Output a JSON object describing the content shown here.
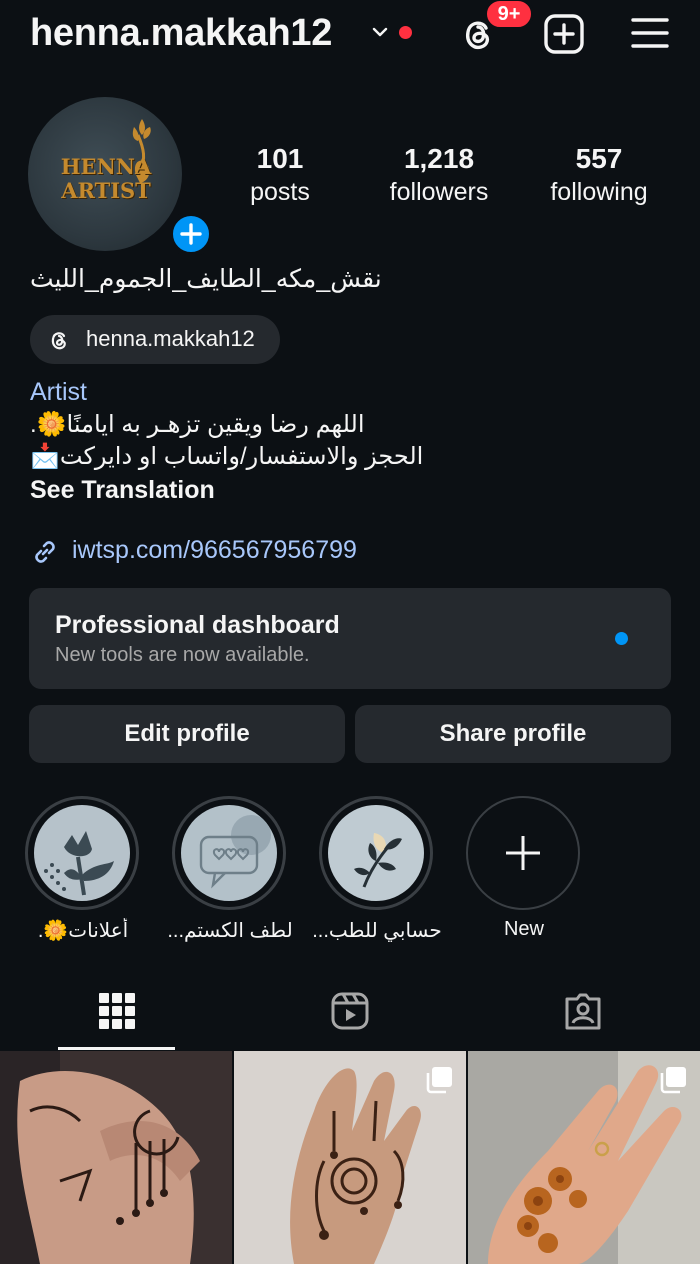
{
  "header": {
    "username": "henna.makkah12",
    "notification_badge": "9+"
  },
  "profile": {
    "avatar_text_line1": "HENNA",
    "avatar_text_line2": "ARTIST",
    "stats": [
      {
        "value": "101",
        "label": "posts"
      },
      {
        "value": "1,218",
        "label": "followers"
      },
      {
        "value": "557",
        "label": "following"
      }
    ],
    "full_name": "نقش_مكه_الطايف_الجموم_الليث",
    "threads_handle": "henna.makkah12",
    "category": "Artist",
    "bio_line1": "اللهم رضا ويقين تزهـر به ايامنًا🌼.",
    "bio_line2": "الحجز والاستفسار/واتساب او دايركت📩",
    "see_translation": "See Translation",
    "link": "iwtsp.com/966567956799"
  },
  "dashboard": {
    "title": "Professional dashboard",
    "subtitle": "New tools are now available."
  },
  "buttons": {
    "edit": "Edit profile",
    "share": "Share profile"
  },
  "highlights": [
    {
      "label": "أعلانات🌼."
    },
    {
      "label": "لطف الكستم..."
    },
    {
      "label": "حسابي للطب..."
    },
    {
      "label": "New"
    }
  ],
  "colors": {
    "background": "#0c1014",
    "accent_blue": "#0095f6",
    "link_blue": "#a8c7fa",
    "badge_red": "#ff3040",
    "card": "#25292e"
  },
  "icons": {
    "threads": "threads-icon",
    "new_post": "plus-square-icon",
    "menu": "hamburger-menu-icon",
    "link": "link-icon",
    "grid_tab": "grid-icon",
    "reels_tab": "reels-icon",
    "tagged_tab": "tagged-user-icon",
    "multi_photo": "multiple-photos-icon"
  }
}
